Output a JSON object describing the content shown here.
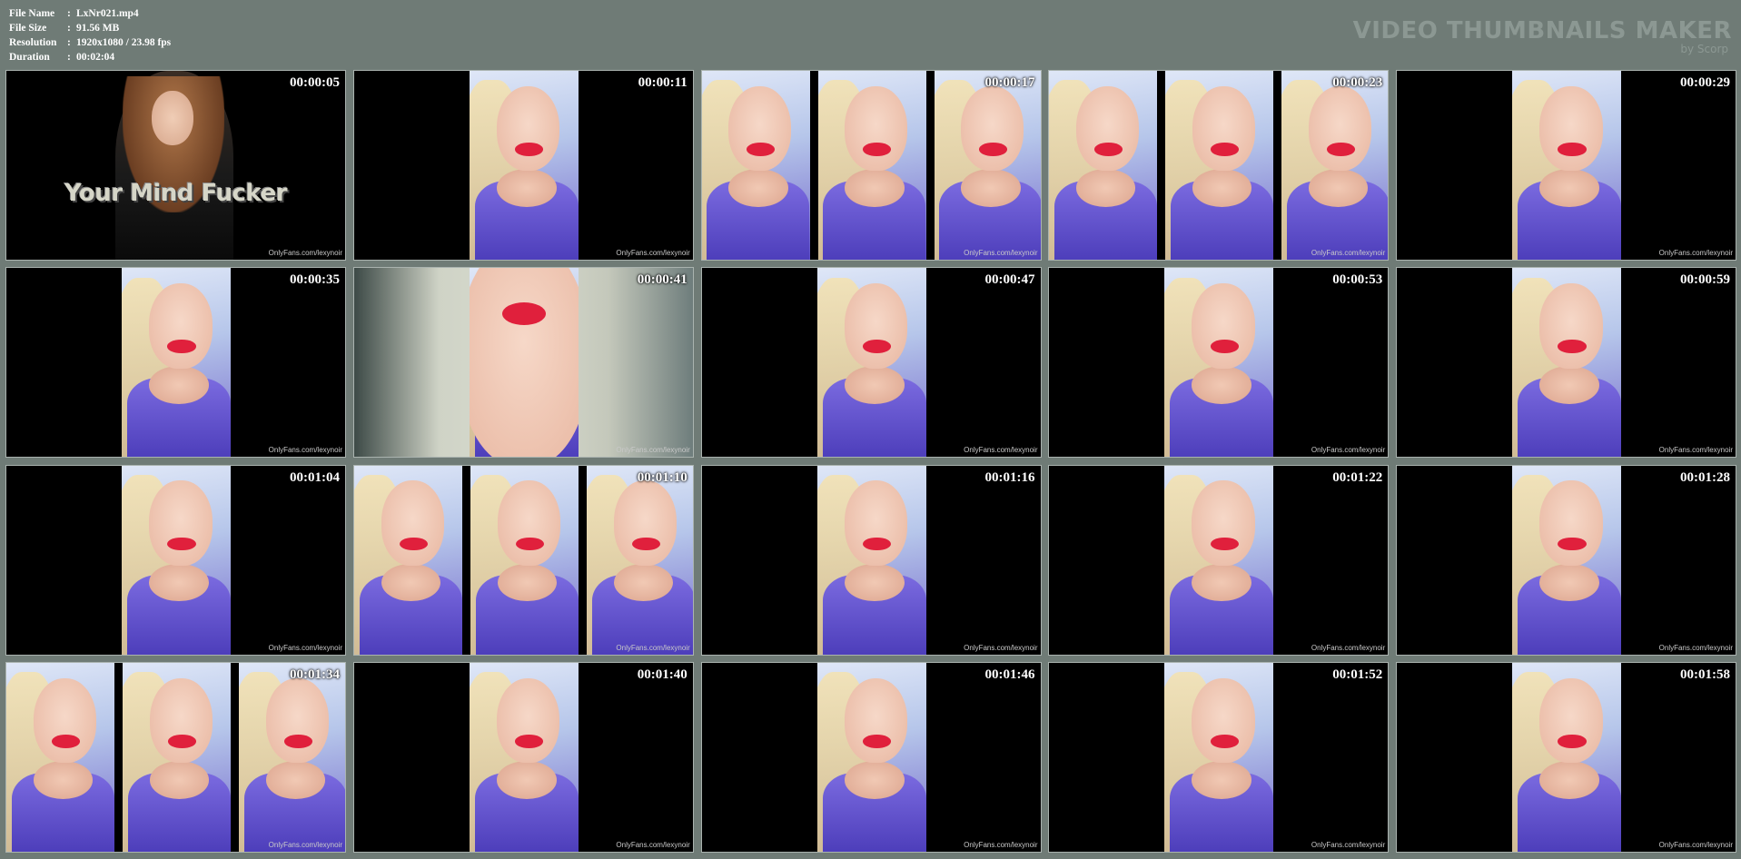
{
  "info": {
    "file_name_label": "File Name",
    "file_name": "LxNr021.mp4",
    "file_size_label": "File Size",
    "file_size": "91.56 MB",
    "resolution_label": "Resolution",
    "resolution": "1920x1080 / 23.98 fps",
    "duration_label": "Duration",
    "duration": "00:02:04",
    "separator": ":"
  },
  "brand": {
    "title": "VIDEO THUMBNAILS MAKER",
    "subtitle": "by Scorp"
  },
  "intro_title": "Your Mind Fucker",
  "watermark": "OnlyFans.com/lexynoir",
  "thumbnails": [
    {
      "time": "00:00:05",
      "layout": "intro"
    },
    {
      "time": "00:00:11",
      "layout": "single"
    },
    {
      "time": "00:00:17",
      "layout": "triple"
    },
    {
      "time": "00:00:23",
      "layout": "triple"
    },
    {
      "time": "00:00:29",
      "layout": "single"
    },
    {
      "time": "00:00:35",
      "layout": "single"
    },
    {
      "time": "00:00:41",
      "layout": "blurred"
    },
    {
      "time": "00:00:47",
      "layout": "single"
    },
    {
      "time": "00:00:53",
      "layout": "single"
    },
    {
      "time": "00:00:59",
      "layout": "single"
    },
    {
      "time": "00:01:04",
      "layout": "single"
    },
    {
      "time": "00:01:10",
      "layout": "triple"
    },
    {
      "time": "00:01:16",
      "layout": "single"
    },
    {
      "time": "00:01:22",
      "layout": "single"
    },
    {
      "time": "00:01:28",
      "layout": "single"
    },
    {
      "time": "00:01:34",
      "layout": "triple"
    },
    {
      "time": "00:01:40",
      "layout": "single"
    },
    {
      "time": "00:01:46",
      "layout": "single"
    },
    {
      "time": "00:01:52",
      "layout": "single"
    },
    {
      "time": "00:01:58",
      "layout": "single"
    }
  ]
}
